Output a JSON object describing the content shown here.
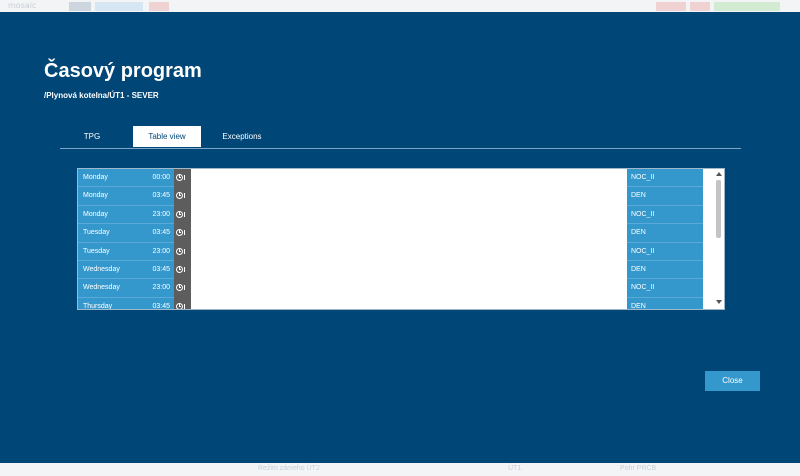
{
  "background": {
    "brand": "mosaic",
    "status_text": "Režim zámeho ÚT2",
    "status_right": "ÚT1",
    "status_far": "Pohr PRCB"
  },
  "dialog": {
    "title": "Časový program",
    "subtitle": "/Plynová kotelna/ÚT1 - SEVER",
    "tabs": [
      {
        "label": "TPG",
        "active": false
      },
      {
        "label": "Table view",
        "active": true
      },
      {
        "label": "Exceptions",
        "active": false
      }
    ],
    "table": {
      "rows": [
        {
          "day": "Monday",
          "time": "00:00",
          "program": "NOC_II"
        },
        {
          "day": "Monday",
          "time": "03:45",
          "program": "DEN"
        },
        {
          "day": "Monday",
          "time": "23:00",
          "program": "NOC_II"
        },
        {
          "day": "Tuesday",
          "time": "03:45",
          "program": "DEN"
        },
        {
          "day": "Tuesday",
          "time": "23:00",
          "program": "NOC_II"
        },
        {
          "day": "Wednesday",
          "time": "03:45",
          "program": "DEN"
        },
        {
          "day": "Wednesday",
          "time": "23:00",
          "program": "NOC_II"
        },
        {
          "day": "Thursday",
          "time": "03:45",
          "program": "DEN"
        }
      ]
    },
    "close_label": "Close"
  },
  "colors": {
    "dialog_bg": "#004677",
    "row_blue": "#3498cd",
    "icon_gray": "#5d5d5d",
    "tab_active_bg": "#ffffff"
  }
}
